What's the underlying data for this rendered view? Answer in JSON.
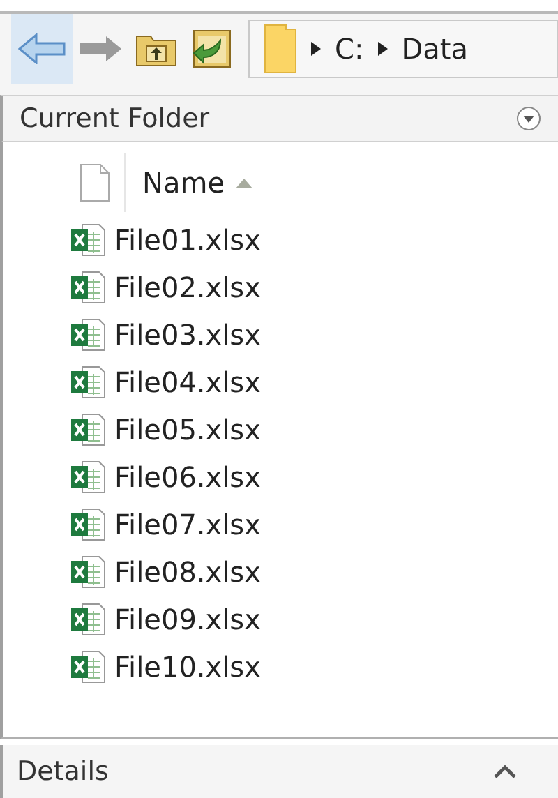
{
  "address_bar": {
    "segments": [
      "C:",
      "Data"
    ]
  },
  "current_folder": {
    "title": "Current Folder",
    "columns": [
      {
        "label": "Name",
        "sorted": true
      }
    ],
    "files": [
      {
        "name": "File01.xlsx"
      },
      {
        "name": "File02.xlsx"
      },
      {
        "name": "File03.xlsx"
      },
      {
        "name": "File04.xlsx"
      },
      {
        "name": "File05.xlsx"
      },
      {
        "name": "File06.xlsx"
      },
      {
        "name": "File07.xlsx"
      },
      {
        "name": "File08.xlsx"
      },
      {
        "name": "File09.xlsx"
      },
      {
        "name": "File10.xlsx"
      }
    ]
  },
  "details": {
    "title": "Details",
    "expanded": false
  }
}
